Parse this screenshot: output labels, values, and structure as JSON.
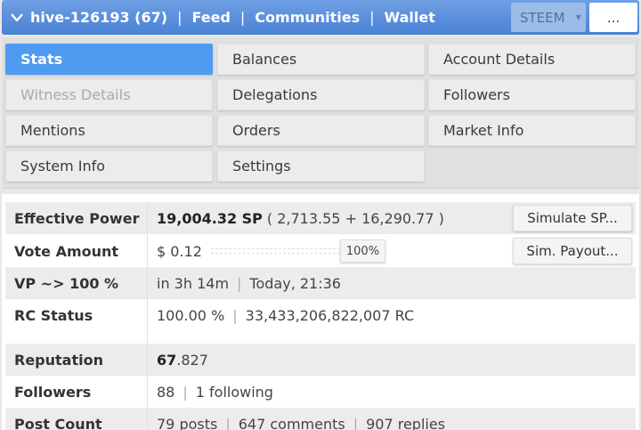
{
  "header": {
    "account": "hive-126193 (67)",
    "links": [
      "Feed",
      "Communities",
      "Wallet"
    ],
    "separator": "|",
    "chain_select": "STEEM",
    "more_label": "...",
    "colors": {
      "bar": "#4a81d4",
      "active_tab": "#4f9bf2"
    }
  },
  "menu": {
    "items": [
      {
        "label": "Stats",
        "state": "active"
      },
      {
        "label": "Balances",
        "state": "normal"
      },
      {
        "label": "Account Details",
        "state": "normal"
      },
      {
        "label": "Witness Details",
        "state": "disabled"
      },
      {
        "label": "Delegations",
        "state": "normal"
      },
      {
        "label": "Followers",
        "state": "normal"
      },
      {
        "label": "Mentions",
        "state": "normal"
      },
      {
        "label": "Orders",
        "state": "normal"
      },
      {
        "label": "Market Info",
        "state": "normal"
      },
      {
        "label": "System Info",
        "state": "normal"
      },
      {
        "label": "Settings",
        "state": "normal"
      }
    ]
  },
  "stats": {
    "effective_power": {
      "label": "Effective Power",
      "value": "19,004.32 SP",
      "detail": "( 2,713.55 + 16,290.77 )",
      "button": "Simulate SP..."
    },
    "vote_amount": {
      "label": "Vote Amount",
      "value": "$ 0.12",
      "slider_percent": "100%",
      "slider_level": 1.0,
      "button": "Sim. Payout..."
    },
    "vp": {
      "label": "VP ~> 100 %",
      "time": "in 3h 14m",
      "when": "Today, 21:36"
    },
    "rc": {
      "label": "RC Status",
      "percent": "100.00 %",
      "amount": "33,433,206,822,007 RC"
    },
    "reputation": {
      "label": "Reputation",
      "int_part": "67",
      "frac_part": ".827"
    },
    "followers": {
      "label": "Followers",
      "count": "88",
      "following": "1 following"
    },
    "post_count": {
      "label": "Post Count",
      "posts": "79 posts",
      "comments": "647 comments",
      "replies": "907 replies"
    }
  }
}
